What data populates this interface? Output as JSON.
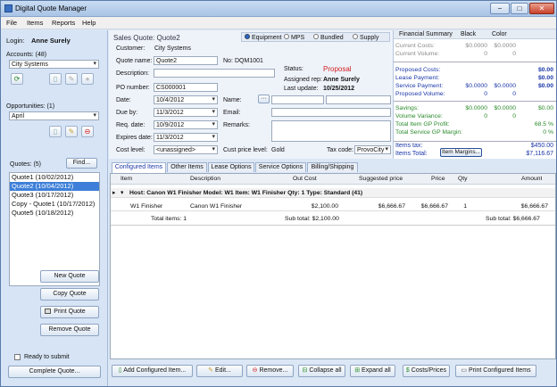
{
  "window": {
    "title": "Digital Quote Manager",
    "buttons": [
      "−",
      "□",
      "✕"
    ]
  },
  "menu": [
    "File",
    "Items",
    "Reports",
    "Help"
  ],
  "left": {
    "login_label": "Login:",
    "login_user": "Anne Surely",
    "accounts_label": "Accounts:  (48)",
    "account_selected": "City Systems",
    "opportunities_label": "Opportunities:  (1)",
    "opportunity_selected": "April",
    "quotes_label": "Quotes:  (5)",
    "find_button": "Find...",
    "quotes": [
      "Quote1 (10/02/2012)",
      "Quote2 (10/04/2012)",
      "Quote3 (10/17/2012)",
      "Copy - Quote1 (10/17/2012)",
      "Quote5 (10/18/2012)"
    ],
    "selected_quote_index": 1,
    "new_quote": "New Quote",
    "copy_quote": "Copy Quote",
    "print_quote": "Print Quote",
    "remove_quote": "Remove Quote",
    "ready_label": "Ready to submit",
    "complete_quote": "Complete Quote..."
  },
  "quote": {
    "title": "Sales Quote: Quote2",
    "modes": [
      "Equipment",
      "MPS",
      "Bundled",
      "Supply"
    ],
    "mode_selected": "Equipment",
    "customer_label": "Customer:",
    "customer": "City Systems",
    "quote_name_label": "Quote name:",
    "quote_name": "Quote2",
    "no_label": "No:",
    "number": "DQM1001",
    "description_label": "Description:",
    "description": "",
    "po_label": "PO number:",
    "po": "CS000001",
    "date_label": "Date:",
    "date": "10/4/2012",
    "due_label": "Due by:",
    "due": "11/3/2012",
    "req_label": "Req. date:",
    "req": "10/9/2012",
    "expires_label": "Expires date:",
    "expires": "11/3/2012",
    "cost_level_label": "Cost level:",
    "cost_level": "<unassigned>",
    "status_label": "Status:",
    "status": "Proposal",
    "assigned_label": "Assigned rep:",
    "assigned": "Anne Surely",
    "last_update_label": "Last update:",
    "last_update": "10/25/2012",
    "name_label": "Name:",
    "email_label": "Email:",
    "remarks_label": "Remarks:",
    "cust_price_label": "Cust price level:",
    "cust_price": "Gold",
    "tax_label": "Tax code:",
    "tax": "ProvoCity",
    "ellipsis_button": "···"
  },
  "summary": {
    "header": [
      "Financial Summary",
      "Black",
      "Color"
    ],
    "rows": [
      {
        "label": "Current Costs:",
        "black": "$0.0000",
        "color": "$0.0000",
        "total": "",
        "style": "gray"
      },
      {
        "label": "Current Volume:",
        "black": "0",
        "color": "0",
        "total": "",
        "style": "gray"
      },
      {
        "label": "Proposed Costs:",
        "black": "",
        "color": "",
        "total": "$0.00",
        "style": "blue"
      },
      {
        "label": "Lease Payment:",
        "black": "",
        "color": "",
        "total": "$0.00",
        "style": "blue"
      },
      {
        "label": "Service Payment:",
        "black": "$0.0000",
        "color": "$0.0000",
        "total": "$0.00",
        "style": "blue"
      },
      {
        "label": "Proposed Volume:",
        "black": "0",
        "color": "0",
        "total": "",
        "style": "blue"
      },
      {
        "label": "Savings:",
        "black": "$0.0000",
        "color": "$0.0000",
        "total": "$0.00",
        "style": "green"
      },
      {
        "label": "Volume Variance:",
        "black": "0",
        "color": "0",
        "total": "",
        "style": "green"
      },
      {
        "label": "Total Item GP Profit:",
        "black": "",
        "color": "",
        "total": "68.5 %",
        "style": "green"
      },
      {
        "label": "Total Service GP Margin:",
        "black": "",
        "color": "",
        "total": "0 %",
        "style": "green"
      }
    ],
    "items_tax_label": "Items tax:",
    "items_tax": "$450.00",
    "items_total_label": "Items Total:",
    "items_total": "$7,116.67",
    "item_margins_button": "Item Margins..."
  },
  "tabs": [
    "Configured Items",
    "Other Items",
    "Lease Options",
    "Service Options",
    "Billing/Shipping"
  ],
  "grid": {
    "headers": [
      "Item",
      "Description",
      "Out Cost",
      "Suggested price",
      "Price",
      "Qty",
      "Amount"
    ],
    "group_row": "Host: Canon W1 Finisher  Model: W1  Item: W1 Finisher  Qty: 1  Type: Standard  (41)",
    "row": [
      "W1 Finisher",
      "Canon W1 Finisher",
      "$2,100.00",
      "$6,666.67",
      "$6,666.67",
      "1",
      "$6,666.67"
    ],
    "total_items": "Total items: 1",
    "sub_total_cost": "Sub total: $2,100.00",
    "sub_total": "Sub total: $6,666.67"
  },
  "bottom": [
    "Add Configured Item...",
    "Edit...",
    "Remove...",
    "Collapse all",
    "Expand all",
    "Costs/Prices",
    "Print Configured Items"
  ]
}
